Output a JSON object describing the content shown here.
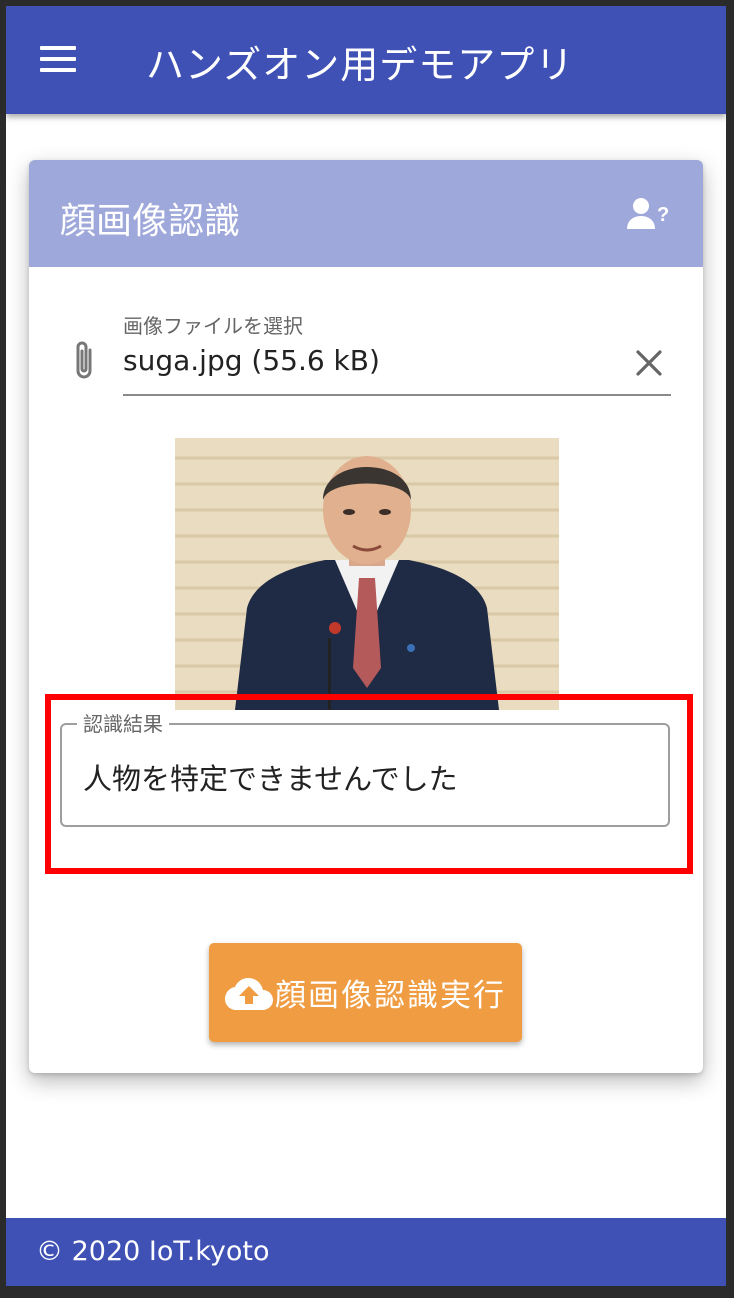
{
  "app_bar": {
    "title": "ハンズオン用デモアプリ"
  },
  "card": {
    "title": "顔画像認識",
    "help_icon": "person-question-icon",
    "file_input": {
      "label": "画像ファイルを選択",
      "value": "suga.jpg (55.6 kB)",
      "prefix_icon": "paperclip-icon",
      "clear_icon": "close-icon"
    },
    "result": {
      "label": "認識結果",
      "value": "人物を特定できませんでした"
    },
    "run_button": {
      "label": "顔画像認識実行",
      "icon": "cloud-upload-icon"
    }
  },
  "footer": {
    "text": "© 2020 IoT.kyoto"
  },
  "colors": {
    "primary": "#3f51b5",
    "card_header": "#9fa8da",
    "accent_button": "#ef9c43",
    "highlight": "#ff0000"
  }
}
